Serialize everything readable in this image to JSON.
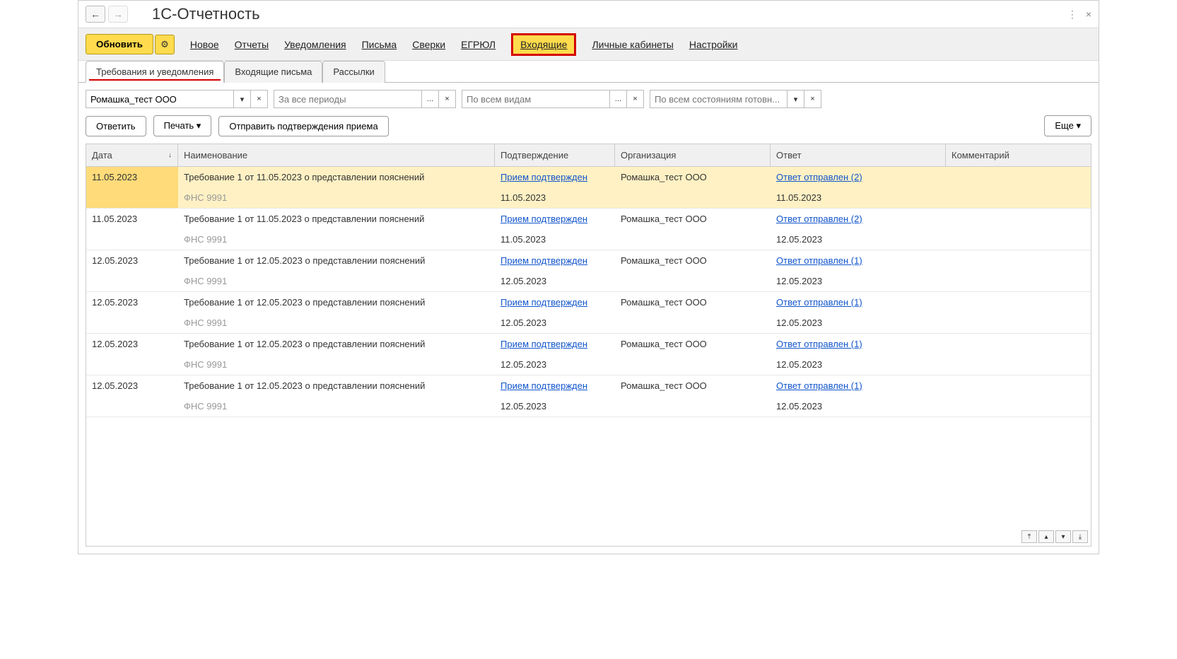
{
  "title": "1С-Отчетность",
  "toolbar": {
    "refresh": "Обновить",
    "nav": [
      "Новое",
      "Отчеты",
      "Уведомления",
      "Письма",
      "Сверки",
      "ЕГРЮЛ",
      "Входящие",
      "Личные кабинеты",
      "Настройки"
    ],
    "highlighted_index": 6
  },
  "tabs": [
    "Требования и уведомления",
    "Входящие письма",
    "Рассылки"
  ],
  "filters": {
    "org": "Ромашка_тест ООО",
    "period_placeholder": "За все периоды",
    "type_placeholder": "По всем видам",
    "status_placeholder": "По всем состояниям готовн...",
    "ellipsis": "...",
    "dropdown": "▾",
    "clear": "×"
  },
  "actions": {
    "reply": "Ответить",
    "print": "Печать",
    "send_confirm": "Отправить подтверждения приема",
    "more": "Еще"
  },
  "columns": {
    "date": "Дата",
    "name": "Наименование",
    "confirm": "Подтверждение",
    "org": "Организация",
    "response": "Ответ",
    "comment": "Комментарий"
  },
  "rows": [
    {
      "date": "11.05.2023",
      "name": "Требование 1 от 11.05.2023 о представлении пояснений",
      "sub": "ФНС 9991",
      "confirm": "Прием подтвержден",
      "confirm_date": "11.05.2023",
      "org": "Ромашка_тест ООО",
      "response": "Ответ отправлен (2)",
      "response_date": "11.05.2023",
      "selected": true
    },
    {
      "date": "11.05.2023",
      "name": "Требование 1 от 11.05.2023 о представлении пояснений",
      "sub": "ФНС 9991",
      "confirm": "Прием подтвержден",
      "confirm_date": "11.05.2023",
      "org": "Ромашка_тест ООО",
      "response": "Ответ отправлен (2)",
      "response_date": "12.05.2023"
    },
    {
      "date": "12.05.2023",
      "name": "Требование 1 от 12.05.2023 о представлении пояснений",
      "sub": "ФНС 9991",
      "confirm": "Прием подтвержден",
      "confirm_date": "12.05.2023",
      "org": "Ромашка_тест ООО",
      "response": "Ответ отправлен (1)",
      "response_date": "12.05.2023"
    },
    {
      "date": "12.05.2023",
      "name": "Требование 1 от 12.05.2023 о представлении пояснений",
      "sub": "ФНС 9991",
      "confirm": "Прием подтвержден",
      "confirm_date": "12.05.2023",
      "org": "Ромашка_тест ООО",
      "response": "Ответ отправлен (1)",
      "response_date": "12.05.2023"
    },
    {
      "date": "12.05.2023",
      "name": "Требование 1 от 12.05.2023 о представлении пояснений",
      "sub": "ФНС 9991",
      "confirm": "Прием подтвержден",
      "confirm_date": "12.05.2023",
      "org": "Ромашка_тест ООО",
      "response": "Ответ отправлен (1)",
      "response_date": "12.05.2023"
    },
    {
      "date": "12.05.2023",
      "name": "Требование 1 от 12.05.2023 о представлении пояснений",
      "sub": "ФНС 9991",
      "confirm": "Прием подтвержден",
      "confirm_date": "12.05.2023",
      "org": "Ромашка_тест ООО",
      "response": "Ответ отправлен (1)",
      "response_date": "12.05.2023"
    }
  ]
}
